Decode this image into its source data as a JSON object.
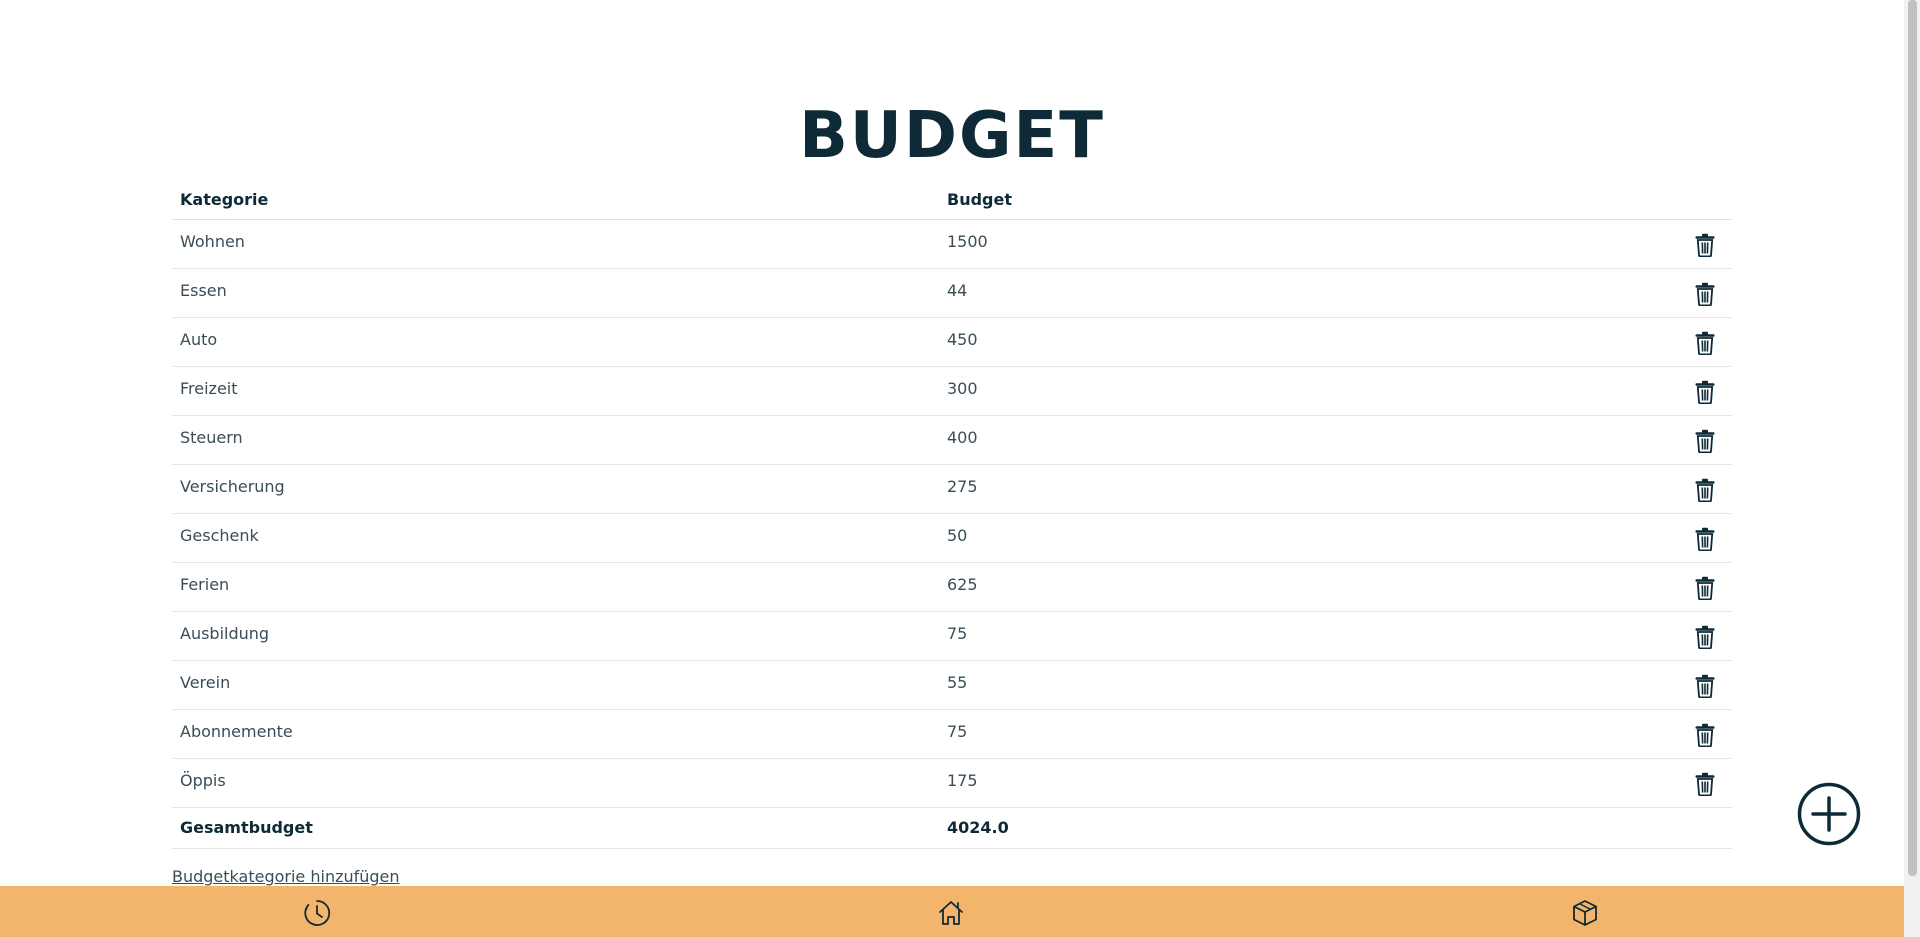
{
  "page": {
    "title": "BUDGET"
  },
  "table": {
    "headers": {
      "category": "Kategorie",
      "budget": "Budget"
    },
    "rows": [
      {
        "category": "Wohnen",
        "budget": "1500"
      },
      {
        "category": "Essen",
        "budget": "44"
      },
      {
        "category": "Auto",
        "budget": "450"
      },
      {
        "category": "Freizeit",
        "budget": "300"
      },
      {
        "category": "Steuern",
        "budget": "400"
      },
      {
        "category": "Versicherung",
        "budget": "275"
      },
      {
        "category": "Geschenk",
        "budget": "50"
      },
      {
        "category": "Ferien",
        "budget": "625"
      },
      {
        "category": "Ausbildung",
        "budget": "75"
      },
      {
        "category": "Verein",
        "budget": "55"
      },
      {
        "category": "Abonnemente",
        "budget": "75"
      },
      {
        "category": "Öppis",
        "budget": "175"
      }
    ],
    "total": {
      "label": "Gesamtbudget",
      "value": "4024.0"
    }
  },
  "actions": {
    "add_category_link": "Budgetkategorie hinzufügen",
    "fab_icon": "plus-circle-icon",
    "row_delete_icon": "trash-icon"
  },
  "bottom_nav": {
    "items": [
      {
        "icon": "history-clock-icon"
      },
      {
        "icon": "home-icon"
      },
      {
        "icon": "box-icon"
      }
    ]
  },
  "colors": {
    "primary": "#0e2a36",
    "nav_background": "#f3b56b",
    "text_muted": "#3a4d57"
  }
}
